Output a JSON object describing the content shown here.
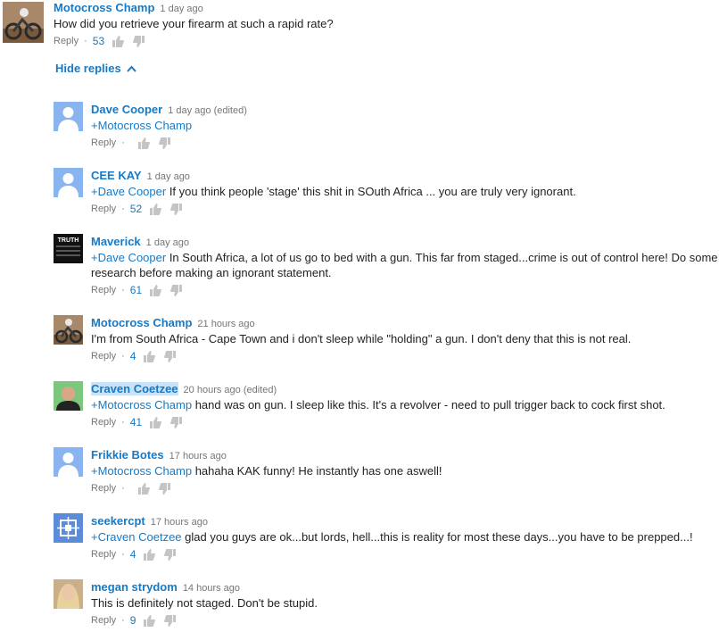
{
  "top_comment": {
    "author": "Motocross Champ",
    "time": "1 day ago",
    "text": "How did you retrieve your firearm at such a rapid rate?",
    "reply_label": "Reply",
    "likes": "53"
  },
  "hide_replies_label": "Hide replies",
  "replies": [
    {
      "author": "Dave Cooper",
      "time": "1 day ago (edited)",
      "mention": "+Motocross Champ",
      "text": "",
      "reply_label": "Reply",
      "likes": "",
      "avatar": "default-avatar"
    },
    {
      "author": "CEE KAY",
      "time": "1 day ago",
      "mention": "+Dave Cooper",
      "text": " If you think people 'stage' this shit in SOuth Africa ... you are truly very ignorant.",
      "reply_label": "Reply",
      "likes": "52",
      "avatar": "default-avatar"
    },
    {
      "author": "Maverick",
      "time": "1 day ago",
      "mention": "+Dave Cooper",
      "text": " In South Africa, a lot of us go to bed with a gun.  This far from staged...crime is out of control here! Do some research before making an ignorant statement.",
      "reply_label": "Reply",
      "likes": "61",
      "avatar": "truth-avatar"
    },
    {
      "author": "Motocross Champ",
      "time": "21 hours ago",
      "mention": "",
      "text": "I'm from South Africa - Cape Town and i don't sleep while \"holding\" a gun. I don't deny that this is not real.",
      "reply_label": "Reply",
      "likes": "4",
      "avatar": "motocross-avatar"
    },
    {
      "author": "Craven Coetzee",
      "time": "20 hours ago (edited)",
      "mention": "+Motocross Champ",
      "text": " hand was on gun. I sleep like this. It's a revolver - need to pull trigger back to cock first shot.",
      "reply_label": "Reply",
      "likes": "41",
      "avatar": "photo-avatar"
    },
    {
      "author": "Frikkie Botes",
      "time": "17 hours ago",
      "mention": "+Motocross Champ",
      "text": " hahaha KAK funny! He instantly has one aswell!",
      "reply_label": "Reply",
      "likes": "",
      "avatar": "default-avatar"
    },
    {
      "author": "seekercpt",
      "time": "17 hours ago",
      "mention": "+Craven Coetzee",
      "text": " glad you guys are ok...but lords, hell...this is reality for most these days...you have to be prepped...!",
      "reply_label": "Reply",
      "likes": "4",
      "avatar": "pattern-avatar"
    },
    {
      "author": "megan strydom",
      "time": "14 hours ago",
      "mention": "",
      "text": " This is definitely not staged. Don't be stupid.",
      "reply_label": "Reply",
      "likes": "9",
      "avatar": "woman-avatar"
    }
  ],
  "avatar_truth_text": "TRUTH",
  "colors": {
    "link": "#167ac6",
    "meta": "#767676",
    "highlight": "#c9e2f7",
    "default_avatar": "#8ab4ef"
  }
}
